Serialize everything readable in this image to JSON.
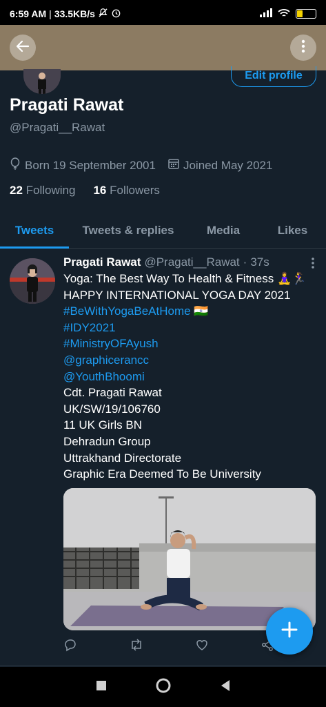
{
  "status_bar": {
    "time": "6:59 AM",
    "separator": "|",
    "speed": "33.5KB/s",
    "battery_level": "29"
  },
  "profile": {
    "display_name": "Pragati Rawat",
    "handle": "@Pragati__Rawat",
    "born": "Born 19 September 2001",
    "joined": "Joined May 2021",
    "following_count": "22",
    "following_label": "Following",
    "followers_count": "16",
    "followers_label": "Followers",
    "edit_profile_label": "Edit profile"
  },
  "tabs": [
    {
      "label": "Tweets",
      "active": true
    },
    {
      "label": "Tweets & replies",
      "active": false
    },
    {
      "label": "Media",
      "active": false
    },
    {
      "label": "Likes",
      "active": false
    }
  ],
  "tweet": {
    "author_name": "Pragati Rawat",
    "author_handle": "@Pragati__Rawat",
    "separator": "·",
    "time_ago": "37s",
    "lines": [
      {
        "text": "Yoga: The Best Way To Health & Fitness 🧘‍♀️🏃‍♀️",
        "link": false
      },
      {
        "text": "HAPPY INTERNATIONAL YOGA DAY 2021",
        "link": false
      },
      {
        "text": "#BeWithYogaBeAtHome",
        "link": true,
        "suffix": " 🇮🇳"
      },
      {
        "text": "#IDY2021",
        "link": true
      },
      {
        "text": "#MinistryOFAyush",
        "link": true
      },
      {
        "text": "@graphicerancc",
        "link": true
      },
      {
        "text": "@YouthBhoomi",
        "link": true
      },
      {
        "text": "Cdt. Pragati Rawat",
        "link": false
      },
      {
        "text": "UK/SW/19/106760",
        "link": false
      },
      {
        "text": "11 UK Girls BN",
        "link": false
      },
      {
        "text": "Dehradun Group",
        "link": false
      },
      {
        "text": "Uttrakhand Directorate",
        "link": false
      },
      {
        "text": "Graphic Era Deemed To Be University",
        "link": false
      }
    ]
  },
  "icons": {
    "back": "back-arrow-icon",
    "more": "more-vertical-icon",
    "reply": "reply-icon",
    "retweet": "retweet-icon",
    "like": "heart-icon",
    "share": "share-icon",
    "compose": "plus-icon"
  },
  "colors": {
    "background": "#15202b",
    "accent": "#1d9bf0",
    "secondary_text": "#8b98a5",
    "banner": "#8c7b62"
  }
}
